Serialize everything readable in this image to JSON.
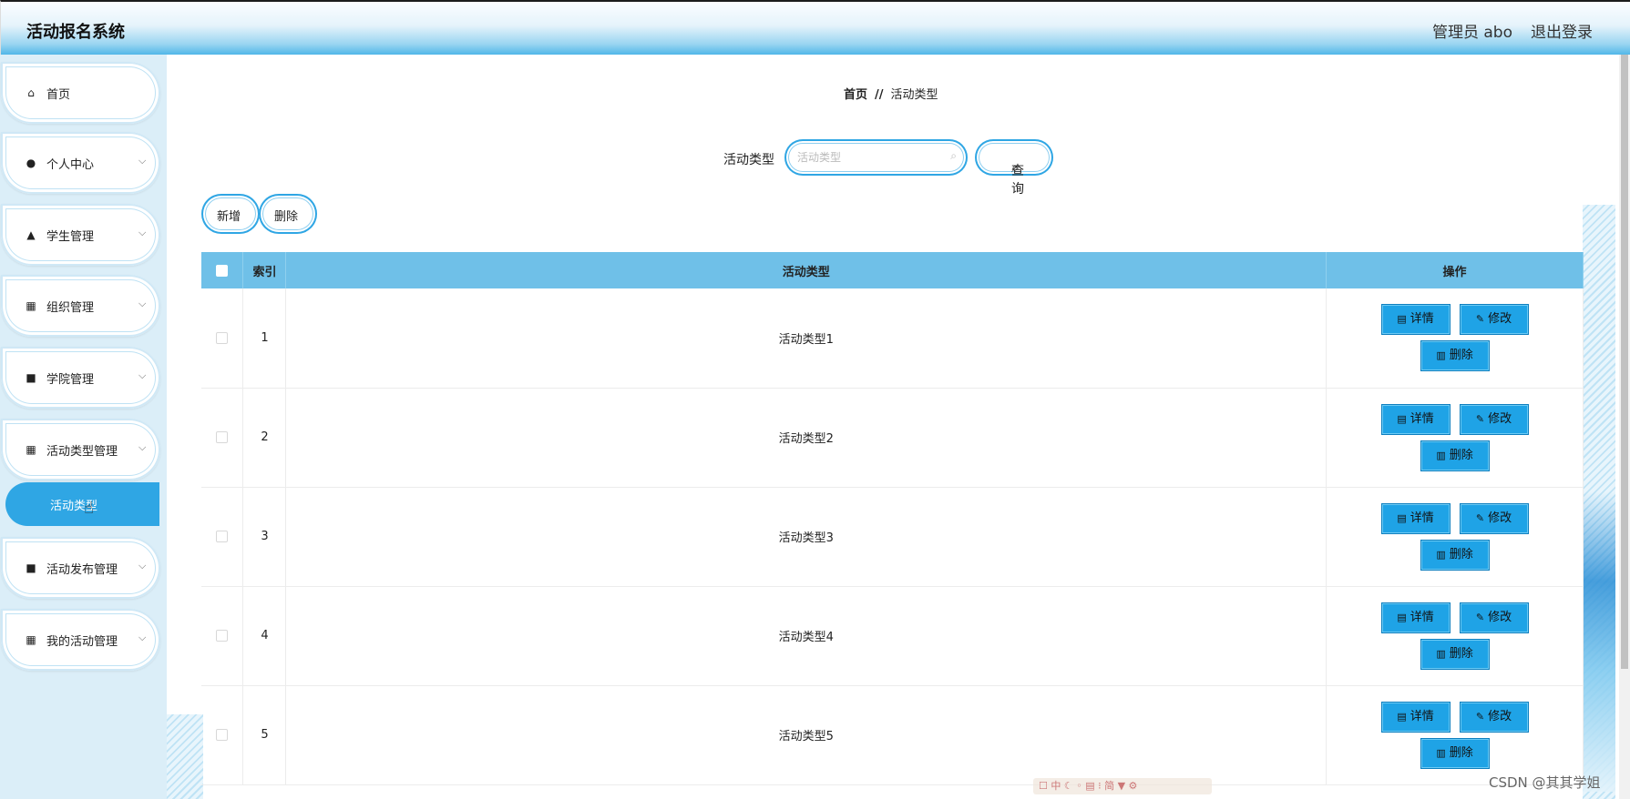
{
  "header": {
    "app_title": "活动报名系统",
    "user_label": "管理员 abo",
    "logout_label": "退出登录"
  },
  "sidebar": {
    "items": [
      {
        "label": "首页",
        "icon": "home-icon"
      },
      {
        "label": "个人中心",
        "icon": "user-icon"
      },
      {
        "label": "学生管理",
        "icon": "student-icon"
      },
      {
        "label": "组织管理",
        "icon": "grid-icon"
      },
      {
        "label": "学院管理",
        "icon": "school-icon"
      },
      {
        "label": "活动类型管理",
        "icon": "grid-icon"
      },
      {
        "label": "活动发布管理",
        "icon": "briefcase-icon"
      },
      {
        "label": "我的活动管理",
        "icon": "grid-icon"
      }
    ],
    "active_submenu": "活动类型"
  },
  "breadcrumb": {
    "home": "首页",
    "separator": "//",
    "current": "活动类型"
  },
  "search": {
    "label": "活动类型",
    "placeholder": "活动类型",
    "value": "",
    "button_label": "查询"
  },
  "toolbar": {
    "add_label": "新增",
    "delete_label": "删除"
  },
  "table": {
    "columns": [
      "",
      "索引",
      "活动类型",
      "操作"
    ],
    "rows": [
      {
        "index": "1",
        "type": "活动类型1"
      },
      {
        "index": "2",
        "type": "活动类型2"
      },
      {
        "index": "3",
        "type": "活动类型3"
      },
      {
        "index": "4",
        "type": "活动类型4"
      },
      {
        "index": "5",
        "type": "活动类型5"
      }
    ],
    "actions": {
      "detail": "详情",
      "edit": "修改",
      "delete": "删除"
    }
  },
  "watermark": "CSDN @其其学姐",
  "colors": {
    "accent": "#2fa6e4",
    "header_row": "#6fc0e8",
    "action_button": "#1fa3e6",
    "sidebar_bg": "#dbeef8"
  }
}
